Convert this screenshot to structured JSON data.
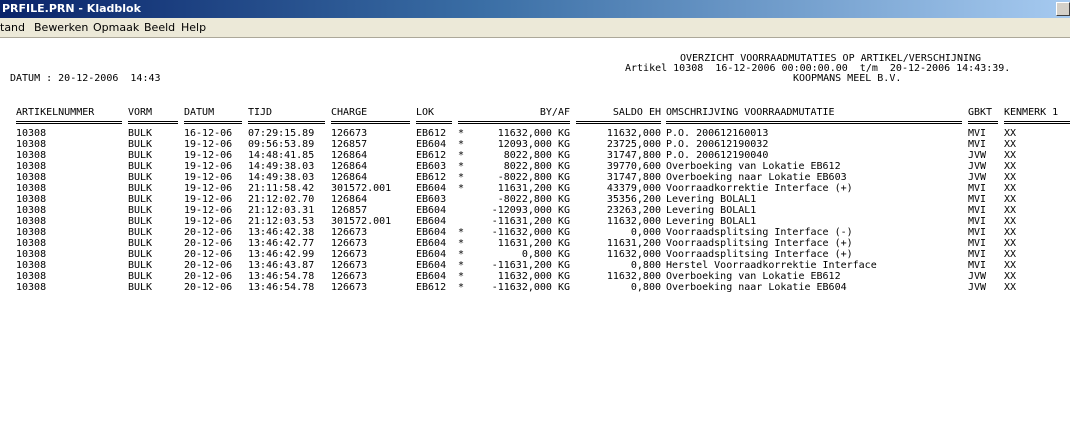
{
  "window": {
    "title": "PRFILE.PRN - Kladblok"
  },
  "menu": [
    "tand",
    "Bewerken",
    "Opmaak",
    "Beeld",
    "Help"
  ],
  "report": {
    "title": "OVERZICHT VOORRAADMUTATIES OP ARTIKEL/VERSCHIJNING",
    "subtitle": "Artikel 10308  16-12-2006 00:00:00.00  t/m  20-12-2006 14:43:39.",
    "company": "KOOPMANS MEEL B.V.",
    "date_line": "DATUM : 20-12-2006  14:43"
  },
  "columns": {
    "artikel": "ARTIKELNUMMER",
    "vorm": "VORM",
    "datum": "DATUM",
    "tijd": "TIJD",
    "charge": "CHARGE",
    "lok": "LOK",
    "byaf": "BY/AF",
    "saldo": "SALDO EH",
    "omschr": "OMSCHRIJVING VOORRAADMUTATIE",
    "gbkt": "GBKT",
    "kenmerk": "KENMERK 1"
  },
  "rows": [
    {
      "artikel": "10308",
      "vorm": "BULK",
      "datum": "16-12-06",
      "tijd": "07:29:15.89",
      "charge": "126673",
      "lok": "EB612",
      "star": "*",
      "byaf": "11632,000 KG",
      "saldo": "11632,000",
      "omschr": "P.O. 200612160013",
      "gbkt": "MVI",
      "kenmerk": "XX"
    },
    {
      "artikel": "10308",
      "vorm": "BULK",
      "datum": "19-12-06",
      "tijd": "09:56:53.89",
      "charge": "126857",
      "lok": "EB604",
      "star": "*",
      "byaf": "12093,000 KG",
      "saldo": "23725,000",
      "omschr": "P.O. 200612190032",
      "gbkt": "MVI",
      "kenmerk": "XX"
    },
    {
      "artikel": "10308",
      "vorm": "BULK",
      "datum": "19-12-06",
      "tijd": "14:48:41.85",
      "charge": "126864",
      "lok": "EB612",
      "star": "*",
      "byaf": "8022,800 KG",
      "saldo": "31747,800",
      "omschr": "P.O. 200612190040",
      "gbkt": "JVW",
      "kenmerk": "XX"
    },
    {
      "artikel": "10308",
      "vorm": "BULK",
      "datum": "19-12-06",
      "tijd": "14:49:38.03",
      "charge": "126864",
      "lok": "EB603",
      "star": "*",
      "byaf": "8022,800 KG",
      "saldo": "39770,600",
      "omschr": "Overboeking van Lokatie EB612",
      "gbkt": "JVW",
      "kenmerk": "XX"
    },
    {
      "artikel": "10308",
      "vorm": "BULK",
      "datum": "19-12-06",
      "tijd": "14:49:38.03",
      "charge": "126864",
      "lok": "EB612",
      "star": "*",
      "byaf": "-8022,800 KG",
      "saldo": "31747,800",
      "omschr": "Overboeking naar Lokatie EB603",
      "gbkt": "JVW",
      "kenmerk": "XX"
    },
    {
      "artikel": "10308",
      "vorm": "BULK",
      "datum": "19-12-06",
      "tijd": "21:11:58.42",
      "charge": "301572.001",
      "lok": "EB604",
      "star": "*",
      "byaf": "11631,200 KG",
      "saldo": "43379,000",
      "omschr": "Voorraadkorrektie Interface (+)",
      "gbkt": "MVI",
      "kenmerk": "XX"
    },
    {
      "artikel": "10308",
      "vorm": "BULK",
      "datum": "19-12-06",
      "tijd": "21:12:02.70",
      "charge": "126864",
      "lok": "EB603",
      "star": "",
      "byaf": "-8022,800 KG",
      "saldo": "35356,200",
      "omschr": "Levering BOLAL1",
      "gbkt": "MVI",
      "kenmerk": "XX"
    },
    {
      "artikel": "10308",
      "vorm": "BULK",
      "datum": "19-12-06",
      "tijd": "21:12:03.31",
      "charge": "126857",
      "lok": "EB604",
      "star": "",
      "byaf": "-12093,000 KG",
      "saldo": "23263,200",
      "omschr": "Levering BOLAL1",
      "gbkt": "MVI",
      "kenmerk": "XX"
    },
    {
      "artikel": "10308",
      "vorm": "BULK",
      "datum": "19-12-06",
      "tijd": "21:12:03.53",
      "charge": "301572.001",
      "lok": "EB604",
      "star": "",
      "byaf": "-11631,200 KG",
      "saldo": "11632,000",
      "omschr": "Levering BOLAL1",
      "gbkt": "MVI",
      "kenmerk": "XX"
    },
    {
      "artikel": "10308",
      "vorm": "BULK",
      "datum": "20-12-06",
      "tijd": "13:46:42.38",
      "charge": "126673",
      "lok": "EB604",
      "star": "*",
      "byaf": "-11632,000 KG",
      "saldo": "0,000",
      "omschr": "Voorraadsplitsing Interface (-)",
      "gbkt": "MVI",
      "kenmerk": "XX"
    },
    {
      "artikel": "10308",
      "vorm": "BULK",
      "datum": "20-12-06",
      "tijd": "13:46:42.77",
      "charge": "126673",
      "lok": "EB604",
      "star": "*",
      "byaf": "11631,200 KG",
      "saldo": "11631,200",
      "omschr": "Voorraadsplitsing Interface (+)",
      "gbkt": "MVI",
      "kenmerk": "XX"
    },
    {
      "artikel": "10308",
      "vorm": "BULK",
      "datum": "20-12-06",
      "tijd": "13:46:42.99",
      "charge": "126673",
      "lok": "EB604",
      "star": "*",
      "byaf": "0,800 KG",
      "saldo": "11632,000",
      "omschr": "Voorraadsplitsing Interface (+)",
      "gbkt": "MVI",
      "kenmerk": "XX"
    },
    {
      "artikel": "10308",
      "vorm": "BULK",
      "datum": "20-12-06",
      "tijd": "13:46:43.87",
      "charge": "126673",
      "lok": "EB604",
      "star": "*",
      "byaf": "-11631,200 KG",
      "saldo": "0,800",
      "omschr": "Herstel Voorraadkorrektie Interface",
      "gbkt": "MVI",
      "kenmerk": "XX"
    },
    {
      "artikel": "10308",
      "vorm": "BULK",
      "datum": "20-12-06",
      "tijd": "13:46:54.78",
      "charge": "126673",
      "lok": "EB604",
      "star": "*",
      "byaf": "11632,000 KG",
      "saldo": "11632,800",
      "omschr": "Overboeking van Lokatie EB612",
      "gbkt": "JVW",
      "kenmerk": "XX"
    },
    {
      "artikel": "10308",
      "vorm": "BULK",
      "datum": "20-12-06",
      "tijd": "13:46:54.78",
      "charge": "126673",
      "lok": "EB612",
      "star": "*",
      "byaf": "-11632,000 KG",
      "saldo": "0,800",
      "omschr": "Overboeking naar Lokatie EB604",
      "gbkt": "JVW",
      "kenmerk": "XX"
    }
  ]
}
